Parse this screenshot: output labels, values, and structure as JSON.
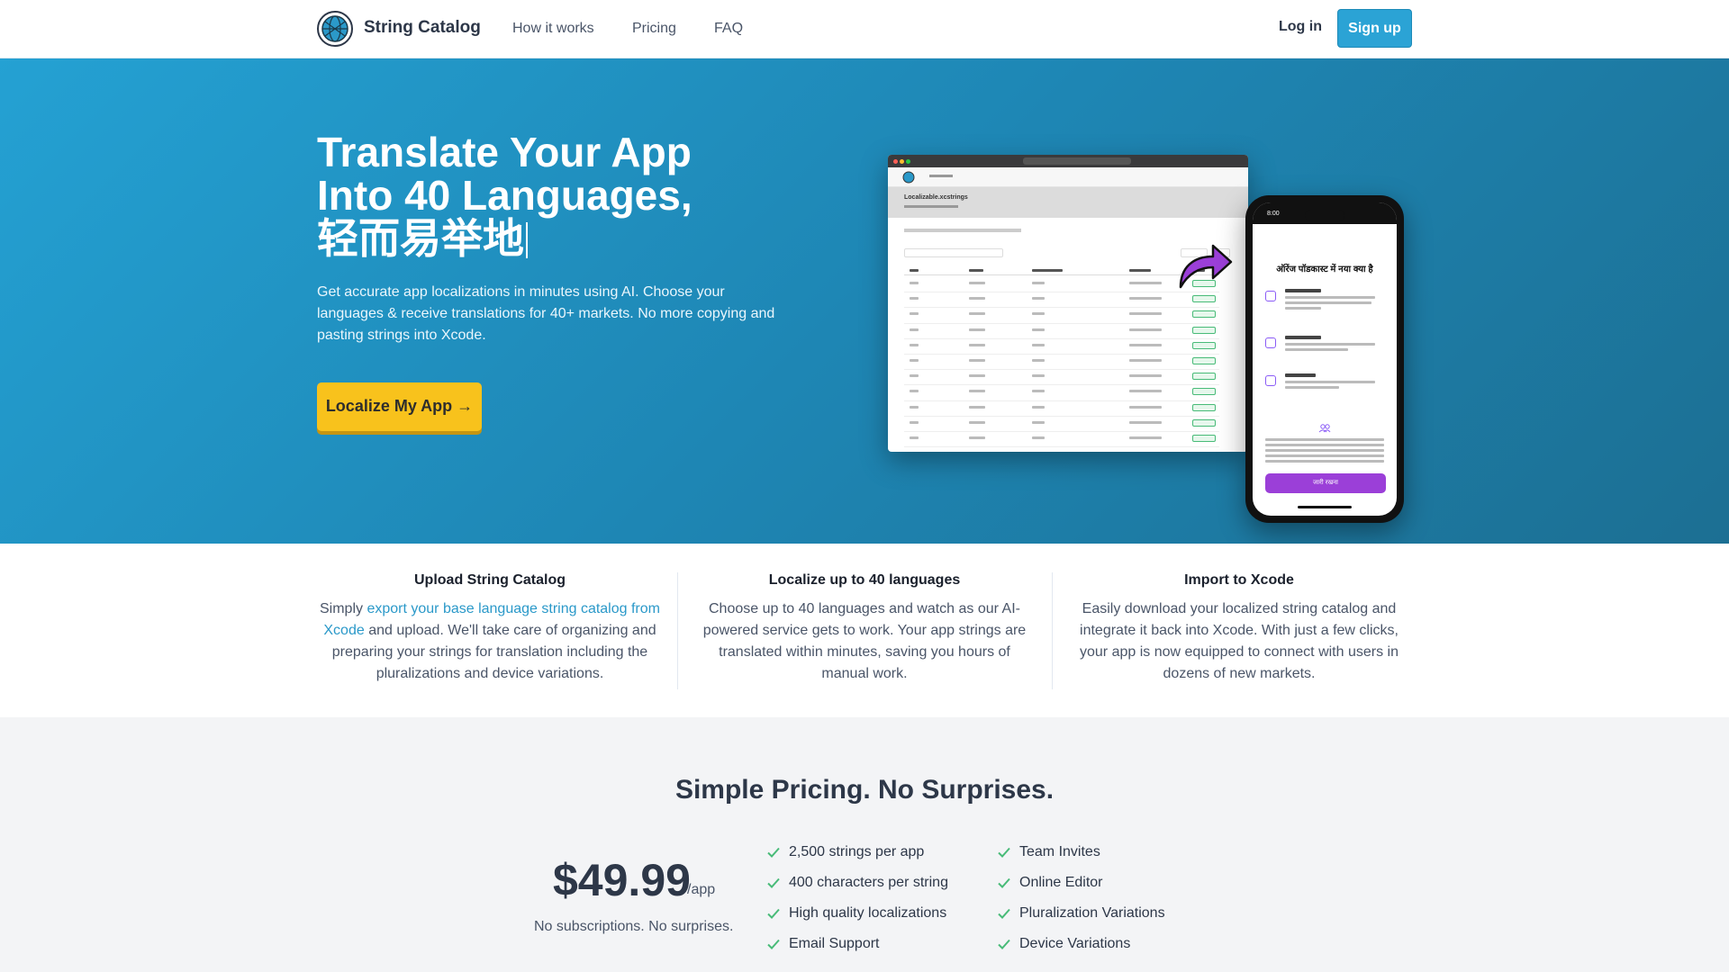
{
  "nav": {
    "brand": "String Catalog",
    "links": [
      "How it works",
      "Pricing",
      "FAQ"
    ],
    "login": "Log in",
    "signup": "Sign up"
  },
  "hero": {
    "title_line1": "Translate Your App",
    "title_line2": "Into 40 Languages,",
    "title_line3": "轻而易举地",
    "description": "Get accurate app localizations in minutes using AI. Choose your languages & receive translations for 40+ markets. No more copying and pasting strings into Xcode.",
    "cta": "Localize My App →"
  },
  "mockup": {
    "file_title": "Localizable.xcstrings",
    "phone_time": "8:00",
    "phone_title": "ऑरेंज पॉडकास्ट में नया क्या है",
    "phone_button": "जारी रखना"
  },
  "features": [
    {
      "title": "Upload String Catalog",
      "body_prefix": "Simply ",
      "body_link": "export your base language string catalog from Xcode",
      "body_suffix": " and upload. We'll take care of organizing and preparing your strings for translation including the pluralizations and device variations."
    },
    {
      "title": "Localize up to 40 languages",
      "body": "Choose up to 40 languages and watch as our AI-powered service gets to work. Your app strings are translated within minutes, saving you hours of manual work."
    },
    {
      "title": "Import to Xcode",
      "body": "Easily download your localized string catalog and integrate it back into Xcode. With just a few clicks, your app is now equipped to connect with users in dozens of new markets."
    }
  ],
  "pricing": {
    "title": "Simple Pricing. No Surprises.",
    "price": "$49.99",
    "per": "/app",
    "note": "No subscriptions. No surprises.",
    "features_col1": [
      "2,500 strings per app",
      "400 characters per string",
      "High quality localizations",
      "Email Support"
    ],
    "features_col2": [
      "Team Invites",
      "Online Editor",
      "Pluralization Variations",
      "Device Variations"
    ]
  },
  "colors": {
    "accent": "#2ba3d5",
    "cta": "#f8c21c",
    "check": "#48bb78"
  }
}
